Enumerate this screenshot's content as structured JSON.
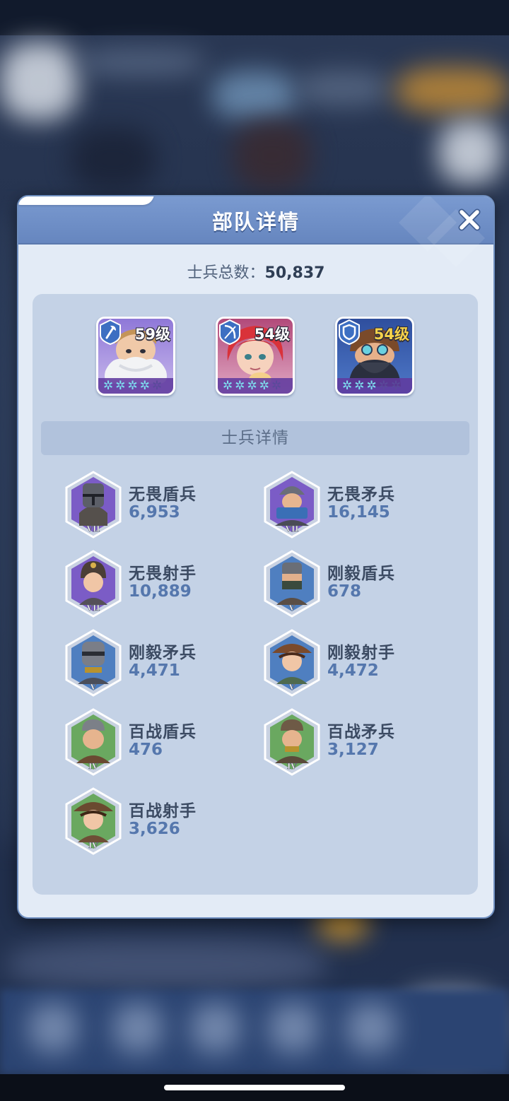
{
  "dialog": {
    "title": "部队详情",
    "total_label": "士兵总数：",
    "total_value": "50,837",
    "section_title": "士兵详情"
  },
  "heroes": [
    {
      "role": "axe-icon",
      "level": "59级",
      "stars_lit": 4,
      "stars_total": 5,
      "level_color": "#ffffff"
    },
    {
      "role": "bow-icon",
      "level": "54级",
      "stars_lit": 4,
      "stars_total": 5,
      "level_color": "#ffffff"
    },
    {
      "role": "shield-icon",
      "level": "54级",
      "stars_lit": 3,
      "stars_total": 5,
      "level_color": "#f5d24a"
    }
  ],
  "troops": [
    {
      "name": "无畏盾兵",
      "count": "6,953",
      "tier": "VII"
    },
    {
      "name": "无畏矛兵",
      "count": "16,145",
      "tier": "VII"
    },
    {
      "name": "无畏射手",
      "count": "10,889",
      "tier": "VII"
    },
    {
      "name": "刚毅盾兵",
      "count": "678",
      "tier": "V"
    },
    {
      "name": "刚毅矛兵",
      "count": "4,471",
      "tier": "V"
    },
    {
      "name": "刚毅射手",
      "count": "4,472",
      "tier": "V"
    },
    {
      "name": "百战盾兵",
      "count": "476",
      "tier": "IV"
    },
    {
      "name": "百战矛兵",
      "count": "3,127",
      "tier": "IV"
    },
    {
      "name": "百战射手",
      "count": "3,626",
      "tier": "IV"
    }
  ],
  "colors": {
    "tier_VII": "#7b5cc6",
    "tier_V": "#4f7fc0",
    "tier_IV": "#6aa860",
    "header": "#6f8fc6",
    "count_text": "#5577ad"
  }
}
